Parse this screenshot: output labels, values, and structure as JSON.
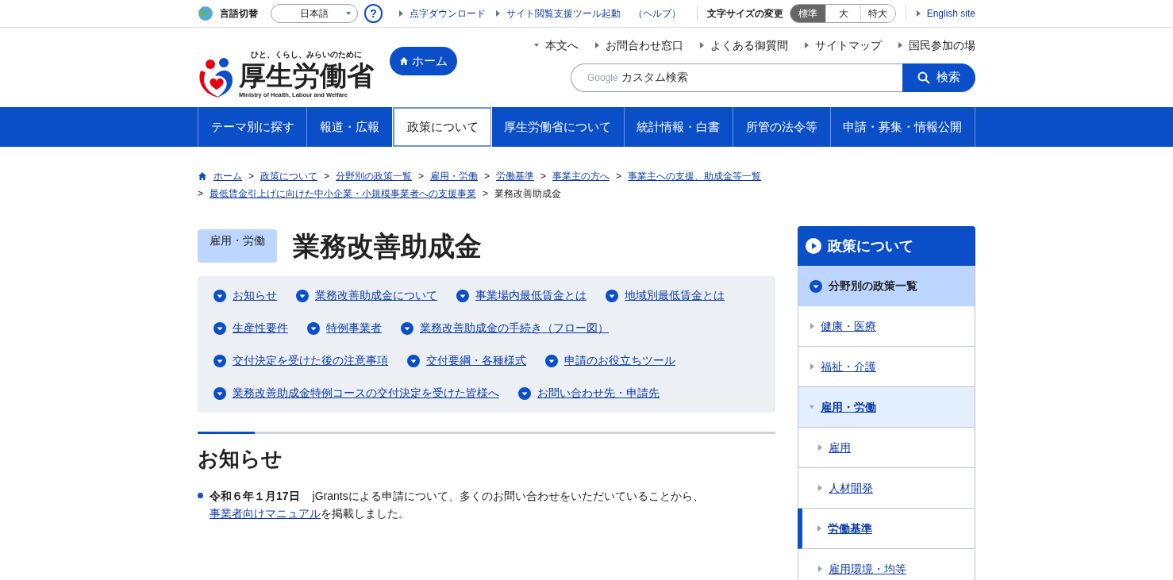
{
  "utility_bar": {
    "language_label": "言語切替",
    "language_select": "日本語",
    "help": "?",
    "links": [
      {
        "label": "点字ダウンロード"
      },
      {
        "label": "サイト閲覧支援ツール起動",
        "help": "（ヘルプ）"
      }
    ],
    "font_size_label": "文字サイズの変更",
    "font_sizes": [
      {
        "label": "標準",
        "selected": true
      },
      {
        "label": "大",
        "selected": false
      },
      {
        "label": "特大",
        "selected": false
      }
    ],
    "english": "English site"
  },
  "header": {
    "tagline": "ひと、くらし、みらいのために",
    "name": "厚生労働省",
    "english_name": "Ministry of Health, Labour and Welfare",
    "home_button": "ホーム",
    "links": [
      {
        "label": "本文へ",
        "kind": "down"
      },
      {
        "label": "お問合わせ窓口",
        "kind": "right"
      },
      {
        "label": "よくある御質問",
        "kind": "right"
      },
      {
        "label": "サイトマップ",
        "kind": "right"
      },
      {
        "label": "国民参加の場",
        "kind": "right"
      }
    ],
    "search": {
      "brand": "Google",
      "placeholder": "カスタム検索",
      "button": "検索"
    }
  },
  "global_nav": [
    {
      "label": "テーマ別に探す",
      "selected": false
    },
    {
      "label": "報道・広報",
      "selected": false
    },
    {
      "label": "政策について",
      "selected": true
    },
    {
      "label": "厚生労働省について",
      "selected": false
    },
    {
      "label": "統計情報・白書",
      "selected": false
    },
    {
      "label": "所管の法令等",
      "selected": false
    },
    {
      "label": "申請・募集・情報公開",
      "selected": false
    }
  ],
  "breadcrumb": [
    {
      "label": "ホーム",
      "link": true
    },
    {
      "separator": ">",
      "label": "政策について",
      "link": true
    },
    {
      "separator": ">",
      "label": "分野別の政策一覧",
      "link": true
    },
    {
      "separator": ">",
      "label": "雇用・労働",
      "link": true
    },
    {
      "separator": ">",
      "label": "労働基準",
      "link": true
    },
    {
      "separator": ">",
      "label": "事業主の方へ",
      "link": true
    },
    {
      "separator": ">",
      "label": "事業主への支援、助成金等一覧",
      "link": true
    },
    {
      "separator": ">",
      "label": "最低賃金引上げに向けた中小企業・小規模事業者への支援事業",
      "link": true
    },
    {
      "separator": ">",
      "label": "業務改善助成金",
      "link": false
    }
  ],
  "page": {
    "category": "雇用・労働",
    "title": "業務改善助成金"
  },
  "anchor_rows": [
    [
      "お知らせ",
      "業務改善助成金について",
      "事業場内最低賃金とは",
      "地域別最低賃金とは"
    ],
    [
      "生産性要件",
      "特例事業者",
      "業務改善助成金の手続き（フロー図）"
    ],
    [
      "交付決定を受けた後の注意事項",
      "交付要綱・各種様式",
      "申請のお役立ちツール"
    ],
    [
      "業務改善助成金特例コースの交付決定を受けた皆様へ",
      "お問い合わせ先・申請先"
    ]
  ],
  "news": {
    "heading": "お知らせ",
    "items": [
      {
        "date": "令和６年１月17日",
        "text_before": "jGrantsによる申請について、多くのお問い合わせをいただいていることから、",
        "link": "事業者向けマニュアル",
        "text_after": "を掲載しました。"
      }
    ]
  },
  "sidebar": {
    "title": "政策について",
    "section": "分野別の政策一覧",
    "items": [
      {
        "label": "健康・医療",
        "expanded": false,
        "selected": false
      },
      {
        "label": "福祉・介護",
        "expanded": false,
        "selected": false
      },
      {
        "label": "雇用・労働",
        "expanded": true,
        "selected": false,
        "children": [
          {
            "label": "雇用",
            "selected": false
          },
          {
            "label": "人材開発",
            "selected": false
          },
          {
            "label": "労働基準",
            "selected": true
          },
          {
            "label": "雇用環境・均等",
            "selected": false
          }
        ]
      }
    ]
  }
}
